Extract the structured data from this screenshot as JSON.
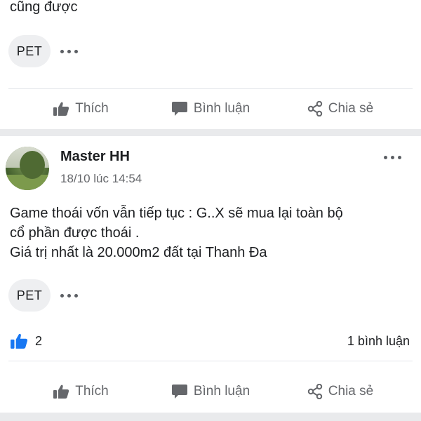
{
  "post_prev": {
    "text_tail": "cũng được",
    "tag": "PET",
    "actions": {
      "like": "Thích",
      "comment": "Bình luận",
      "share": "Chia sẻ"
    }
  },
  "post": {
    "author": "Master HH",
    "timestamp": "18/10 lúc 14:54",
    "lines": [
      "Game thoái vốn vẫn tiếp tục : G..X sẽ mua lại toàn bộ",
      "cổ phần được thoái .",
      "Giá trị nhất là 20.000m2 đất tại Thanh Đa"
    ],
    "tag": "PET",
    "like_count": "2",
    "comment_count": "1 bình luận",
    "actions": {
      "like": "Thích",
      "comment": "Bình luận",
      "share": "Chia sẻ"
    }
  },
  "colors": {
    "accent_like": "#1877f2",
    "muted": "#65676b",
    "band": "#e9eaec"
  },
  "icons": {
    "like": "thumbs-up-icon",
    "comment": "speech-bubble-icon",
    "share": "share-icon",
    "more": "more-dots-icon"
  }
}
